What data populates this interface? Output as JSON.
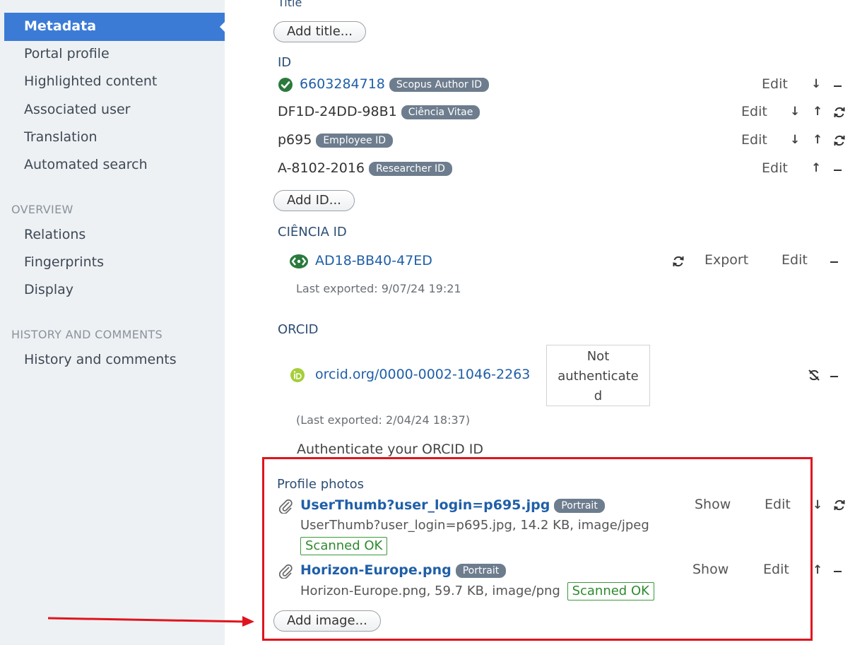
{
  "sidebar": {
    "items": [
      {
        "label": "Metadata"
      },
      {
        "label": "Portal profile"
      },
      {
        "label": "Highlighted content"
      },
      {
        "label": "Associated user"
      },
      {
        "label": "Translation"
      },
      {
        "label": "Automated search"
      }
    ],
    "overview_heading": "OVERVIEW",
    "overview_items": [
      {
        "label": "Relations"
      },
      {
        "label": "Fingerprints"
      },
      {
        "label": "Display"
      }
    ],
    "history_heading": "HISTORY AND COMMENTS",
    "history_items": [
      {
        "label": "History and comments"
      }
    ]
  },
  "title_section": {
    "label": "Title",
    "add_button": "Add title..."
  },
  "id_section": {
    "label": "ID",
    "rows": [
      {
        "value": "6603284718",
        "tag": "Scopus Author ID",
        "edit": "Edit"
      },
      {
        "value": "DF1D-24DD-98B1",
        "tag": "Ciência Vitae",
        "edit": "Edit"
      },
      {
        "value": "p695",
        "tag": "Employee ID",
        "edit": "Edit"
      },
      {
        "value": "A-8102-2016",
        "tag": "Researcher ID",
        "edit": "Edit"
      }
    ],
    "add_button": "Add ID..."
  },
  "ciencia_section": {
    "label": "CIÊNCIA ID",
    "value": "AD18-BB40-47ED",
    "export": "Export",
    "edit": "Edit",
    "last_exported": "Last exported: 9/07/24 19:21"
  },
  "orcid_section": {
    "label": "ORCID",
    "value": "orcid.org/0000-0002-1046-2263",
    "status": [
      "Not",
      "authenticate",
      "d"
    ],
    "last_exported": "(Last exported: 2/04/24 18:37)",
    "authenticate": "Authenticate your ORCID ID"
  },
  "photos_section": {
    "label": "Profile photos",
    "files": [
      {
        "name": "UserThumb?user_login=p695.jpg",
        "tag": "Portrait",
        "details": "UserThumb?user_login=p695.jpg, 14.2 KB, image/jpeg",
        "scan": "Scanned OK",
        "show": "Show",
        "edit": "Edit"
      },
      {
        "name": "Horizon-Europe.png",
        "tag": "Portrait",
        "details": "Horizon-Europe.png, 59.7 KB, image/png",
        "scan": "Scanned OK",
        "show": "Show",
        "edit": "Edit"
      }
    ],
    "add_button": "Add image..."
  },
  "colors": {
    "sidebar_bg": "#eef1f4",
    "sidebar_active": "#3b7bd6",
    "link": "#1f5fa8",
    "tag_bg": "#6d7d8e",
    "scan_green": "#2e8a2e",
    "highlight_red": "#e0141e"
  }
}
